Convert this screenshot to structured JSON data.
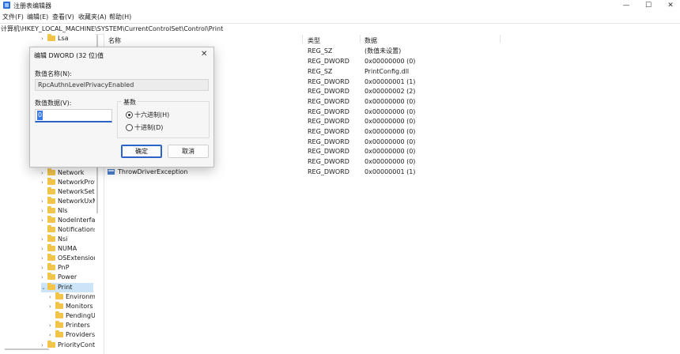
{
  "window": {
    "title": "注册表编辑器"
  },
  "menu": [
    "文件(F)",
    "编辑(E)",
    "查看(V)",
    "收藏夹(A)",
    "帮助(H)"
  ],
  "address": "计算机\\HKEY_LOCAL_MACHINE\\SYSTEM\\CurrentControlSet\\Control\\Print",
  "tree": [
    {
      "label": "Lsa",
      "level": 1,
      "chevron": "›"
    },
    {
      "label": "Network",
      "level": 1,
      "chevron": "›"
    },
    {
      "label": "NetworkProv",
      "level": 1,
      "chevron": "›"
    },
    {
      "label": "NetworkSetu",
      "level": 1,
      "chevron": ""
    },
    {
      "label": "NetworkUxM",
      "level": 1,
      "chevron": "›"
    },
    {
      "label": "Nls",
      "level": 1,
      "chevron": "›"
    },
    {
      "label": "NodeInterfac",
      "level": 1,
      "chevron": "›"
    },
    {
      "label": "Notifications",
      "level": 1,
      "chevron": ""
    },
    {
      "label": "Nsi",
      "level": 1,
      "chevron": "›"
    },
    {
      "label": "NUMA",
      "level": 1,
      "chevron": "›"
    },
    {
      "label": "OSExtensionI",
      "level": 1,
      "chevron": "›"
    },
    {
      "label": "PnP",
      "level": 1,
      "chevron": "›"
    },
    {
      "label": "Power",
      "level": 1,
      "chevron": "›"
    },
    {
      "label": "Print",
      "level": 1,
      "chevron": "⌄",
      "selected": true
    },
    {
      "label": "Environme",
      "level": 2,
      "chevron": "›"
    },
    {
      "label": "Monitors",
      "level": 2,
      "chevron": "›"
    },
    {
      "label": "PendingU",
      "level": 2,
      "chevron": ""
    },
    {
      "label": "Printers",
      "level": 2,
      "chevron": "›"
    },
    {
      "label": "Providers",
      "level": 2,
      "chevron": "›"
    },
    {
      "label": "PriorityConta",
      "level": 1,
      "chevron": "›"
    }
  ],
  "list": {
    "headers": {
      "name": "名称",
      "type": "类型",
      "data": "数据"
    },
    "rows": [
      {
        "name": "",
        "type": "REG_SZ",
        "data": "(数值未设置)"
      },
      {
        "name": "",
        "type": "REG_DWORD",
        "data": "0x00000000 (0)"
      },
      {
        "name": "",
        "type": "REG_SZ",
        "data": "PrintConfig.dll"
      },
      {
        "name": "",
        "type": "REG_DWORD",
        "data": "0x00000001 (1)"
      },
      {
        "name": "",
        "type": "REG_DWORD",
        "data": "0x00000002 (2)"
      },
      {
        "name": "",
        "type": "REG_DWORD",
        "data": "0x00000000 (0)"
      },
      {
        "name": "",
        "type": "REG_DWORD",
        "data": "0x00000000 (0)"
      },
      {
        "name": "",
        "type": "REG_DWORD",
        "data": "0x00000000 (0)"
      },
      {
        "name": "",
        "type": "REG_DWORD",
        "data": "0x00000000 (0)"
      },
      {
        "name": "",
        "type": "REG_DWORD",
        "data": "0x00000000 (0)"
      },
      {
        "name": "",
        "type": "REG_DWORD",
        "data": "0x00000000 (0)"
      },
      {
        "name": "",
        "type": "REG_DWORD",
        "data": "0x00000000 (0)"
      },
      {
        "name": "ThrowDriverException",
        "type": "REG_DWORD",
        "data": "0x00000001 (1)"
      }
    ]
  },
  "dialog": {
    "title": "编辑 DWORD (32 位)值",
    "value_name_label": "数值名称(N):",
    "value_name": "RpcAuthnLevelPrivacyEnabled",
    "value_data_label": "数值数据(V):",
    "value_data": "0",
    "base_label": "基数",
    "hex_label": "十六进制(H)",
    "dec_label": "十进制(D)",
    "selected_base": "hex",
    "ok": "确定",
    "cancel": "取消"
  }
}
